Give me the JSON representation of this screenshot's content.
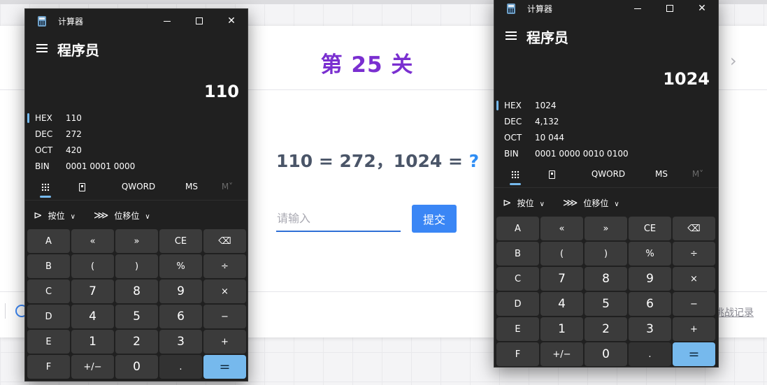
{
  "page": {
    "level_title": "第 25 关",
    "question_main": "110 = 272，1024 = ",
    "question_mark": "?",
    "input_placeholder": "请输入",
    "submit_label": "提交",
    "history_link": "挑战记录"
  },
  "calculators": [
    {
      "window_title": "计算器",
      "mode_title": "程序员",
      "display": "110",
      "radix": [
        {
          "label": "HEX",
          "value": "110",
          "active": true
        },
        {
          "label": "DEC",
          "value": "272",
          "active": false
        },
        {
          "label": "OCT",
          "value": "420",
          "active": false
        },
        {
          "label": "BIN",
          "value": "0001 0001 0000",
          "active": false
        }
      ],
      "tabs": {
        "word_size": "QWORD",
        "ms": "MS",
        "m_list": "M˅"
      },
      "bitops": {
        "bitwise": "按位",
        "bitshift": "位移位"
      },
      "keys": [
        "A",
        "«",
        "»",
        "CE",
        "⌫",
        "B",
        "(",
        ")",
        "%",
        "÷",
        "C",
        "7",
        "8",
        "9",
        "×",
        "D",
        "4",
        "5",
        "6",
        "−",
        "E",
        "1",
        "2",
        "3",
        "+",
        "F",
        "+/−",
        "0",
        ".",
        "="
      ]
    },
    {
      "window_title": "计算器",
      "mode_title": "程序员",
      "display": "1024",
      "radix": [
        {
          "label": "HEX",
          "value": "1024",
          "active": true
        },
        {
          "label": "DEC",
          "value": "4,132",
          "active": false
        },
        {
          "label": "OCT",
          "value": "10 044",
          "active": false
        },
        {
          "label": "BIN",
          "value": "0001 0000 0010 0100",
          "active": false
        }
      ],
      "tabs": {
        "word_size": "QWORD",
        "ms": "MS",
        "m_list": "M˅"
      },
      "bitops": {
        "bitwise": "按位",
        "bitshift": "位移位"
      },
      "keys": [
        "A",
        "«",
        "»",
        "CE",
        "⌫",
        "B",
        "(",
        ")",
        "%",
        "÷",
        "C",
        "7",
        "8",
        "9",
        "×",
        "D",
        "4",
        "5",
        "6",
        "−",
        "E",
        "1",
        "2",
        "3",
        "+",
        "F",
        "+/−",
        "0",
        ".",
        "="
      ]
    }
  ],
  "colors": {
    "title_purple": "#7a2fd0",
    "accent_blue": "#3a86f5",
    "calc_bg": "#202020",
    "calc_key": "#3b3b3b",
    "calc_equals": "#76b9ed"
  }
}
